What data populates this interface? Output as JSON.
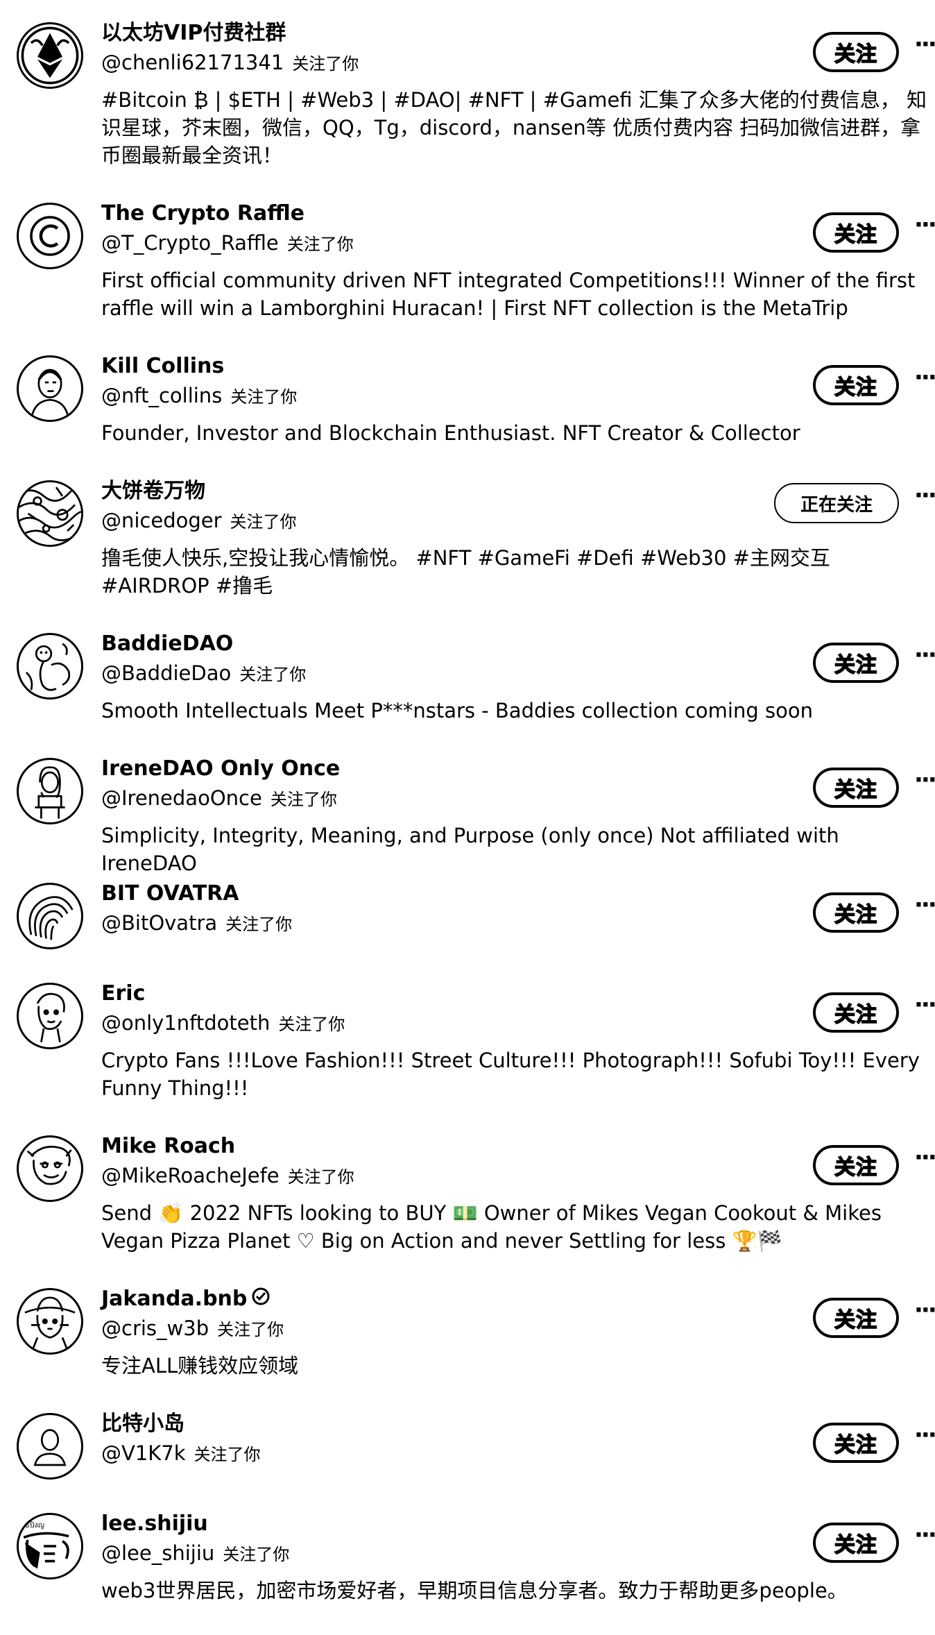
{
  "follow_label": "关注",
  "following_label": "正在关注",
  "follows_you_label": "关注了你",
  "users": [
    {
      "name": "以太坊VIP付费社群",
      "handle": "@chenli62171341",
      "bio": "#Bitcoin ₿ | $ETH | #Web3 | #DAO| #NFT | #Gamefi 汇集了众多大佬的付费信息， 知识星球，芥末圈，微信，QQ，Tg，discord，nansen等 优质付费内容 扫码加微信进群，拿币圈最新最全资讯！",
      "following": false,
      "verified": false,
      "avatar": "ethereum-dragon-logo"
    },
    {
      "name": "The Crypto Raffle",
      "handle": "@T_Crypto_Raffle",
      "bio": "First official community driven NFT integrated Competitions!!! Winner of the first raffle will win a Lamborghini Huracan! | First NFT collection is the MetaTrip",
      "following": false,
      "verified": false,
      "avatar": "copyright-c-logo"
    },
    {
      "name": "Kill Collins",
      "handle": "@nft_collins",
      "bio": "Founder, Investor and Blockchain Enthusiast. NFT Creator & Collector",
      "following": false,
      "verified": false,
      "avatar": "man-portrait"
    },
    {
      "name": "大饼卷万物",
      "handle": "@nicedoger",
      "bio": "撸毛使人快乐,空投让我心情愉悦。 #NFT #GameFi #Defi #Web30 #主网交互 #AIRDROP #撸毛",
      "following": true,
      "verified": false,
      "avatar": "textured-pattern"
    },
    {
      "name": "BaddieDAO",
      "handle": "@BaddieDao",
      "bio": "Smooth Intellectuals Meet P***nstars - Baddies collection coming soon",
      "following": false,
      "verified": false,
      "avatar": "artwork-figure"
    },
    {
      "name": "IreneDAO Only Once",
      "handle": "@IrenedaoOnce",
      "bio": "Simplicity, Integrity, Meaning, and Purpose (only once) Not affiliated with IreneDAO",
      "following": false,
      "verified": false,
      "avatar": "woman-portrait"
    },
    {
      "name": "BIT OVATRA",
      "handle": "@BitOvatra",
      "bio": "",
      "following": false,
      "verified": false,
      "avatar": "fingerprint-swirl"
    },
    {
      "name": "Eric",
      "handle": "@only1nftdoteth",
      "bio": "Crypto Fans !!!Love Fashion!!! Street Culture!!! Photograph!!! Sofubi Toy!!! Every Funny Thing!!!",
      "following": false,
      "verified": false,
      "avatar": "cartoon-face"
    },
    {
      "name": "Mike Roach",
      "handle": "@MikeRoacheJefe",
      "bio": "Send 👏 2022 NFTs looking to BUY 💵 Owner of Mikes Vegan Cookout & Mikes Vegan Pizza Planet ♡ Big on Action and never Settling for less 🏆🏁",
      "following": false,
      "verified": false,
      "avatar": "cartoon-character"
    },
    {
      "name": "Jakanda.bnb",
      "handle": "@cris_w3b",
      "bio": "专注ALL赚钱效应领域",
      "following": false,
      "verified": true,
      "avatar": "cowboy-cat"
    },
    {
      "name": "比特小岛",
      "handle": "@V1K7k",
      "bio": "",
      "following": false,
      "verified": false,
      "avatar": "default-person"
    },
    {
      "name": "lee.shijiu",
      "handle": "@lee_shijiu",
      "bio": "web3世界居民，加密市场爱好者，早期项目信息分享者。致力于帮助更多people。",
      "following": false,
      "verified": false,
      "avatar": "scribble-character"
    }
  ]
}
